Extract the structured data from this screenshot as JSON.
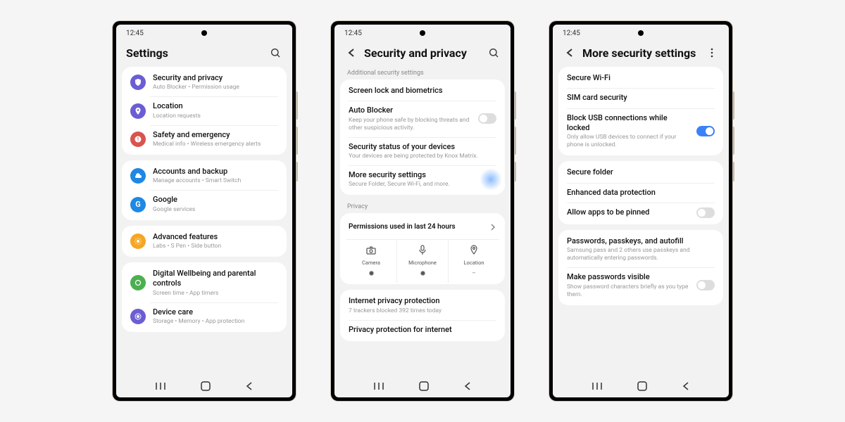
{
  "status_time": "12:45",
  "phones": {
    "left": {
      "title": "Settings",
      "groups": [
        {
          "items": [
            {
              "icon": "shield",
              "color": "#6b5dd3",
              "title": "Security and privacy",
              "sub": "Auto Blocker  •  Permission usage"
            },
            {
              "icon": "pin",
              "color": "#6b5dd3",
              "title": "Location",
              "sub": "Location requests"
            },
            {
              "icon": "alert",
              "color": "#d9534f",
              "title": "Safety and emergency",
              "sub": "Medical info  •  Wireless emergency alerts"
            }
          ]
        },
        {
          "items": [
            {
              "icon": "cloud",
              "color": "#1e88e5",
              "title": "Accounts and backup",
              "sub": "Manage accounts  •  Smart Switch"
            },
            {
              "icon": "google",
              "color": "#1e88e5",
              "title": "Google",
              "sub": "Google services"
            }
          ]
        },
        {
          "items": [
            {
              "icon": "star",
              "color": "#f5a623",
              "title": "Advanced features",
              "sub": "Labs  •  S Pen  •  Side button"
            }
          ]
        },
        {
          "items": [
            {
              "icon": "wellbeing",
              "color": "#4caf50",
              "title": "Digital Wellbeing and parental controls",
              "sub": "Screen time  •  App timers"
            },
            {
              "icon": "device",
              "color": "#6b5dd3",
              "title": "Device care",
              "sub": "Storage  •  Memory  •  App protection"
            }
          ]
        }
      ]
    },
    "mid": {
      "title": "Security and privacy",
      "section1_label": "Additional security settings",
      "group1": [
        {
          "title": "Screen lock and biometrics",
          "sub": ""
        },
        {
          "title": "Auto Blocker",
          "sub": "Keep your phone safe by blocking threats and other suspicious activity.",
          "toggle": "off"
        },
        {
          "title": "Security status of your devices",
          "sub": "Your devices are being protected by Knox Matrix."
        },
        {
          "title": "More security settings",
          "sub": "Secure Folder, Secure Wi-Fi, and more.",
          "highlight": true
        }
      ],
      "privacy_label": "Privacy",
      "perm_title": "Permissions used in last 24 hours",
      "perms": [
        {
          "icon": "camera",
          "label": "Camera",
          "dot": true
        },
        {
          "icon": "mic",
          "label": "Microphone",
          "dot": true
        },
        {
          "icon": "pin",
          "label": "Location",
          "dot": false
        }
      ],
      "group2": [
        {
          "title": "Internet privacy protection",
          "sub": "7 trackers blocked 392 times today"
        },
        {
          "title": "Privacy protection for internet",
          "sub": ""
        }
      ]
    },
    "right": {
      "title": "More security settings",
      "group1": [
        {
          "title": "Secure Wi-Fi",
          "sub": ""
        },
        {
          "title": "SIM card security",
          "sub": ""
        },
        {
          "title": "Block USB connections while locked",
          "sub": "Only allow USB devices to connect if your phone is unlocked.",
          "toggle": "on"
        }
      ],
      "group2": [
        {
          "title": "Secure folder",
          "sub": ""
        },
        {
          "title": "Enhanced data protection",
          "sub": ""
        },
        {
          "title": "Allow apps to be pinned",
          "sub": "",
          "toggle": "off"
        }
      ],
      "group3": [
        {
          "title": "Passwords, passkeys, and autofill",
          "sub": "Samsung pass and 2 others use passkeys and automatically entering passwords."
        },
        {
          "title": "Make passwords visible",
          "sub": "Show password characters briefly as you type them.",
          "toggle": "off"
        }
      ]
    }
  }
}
